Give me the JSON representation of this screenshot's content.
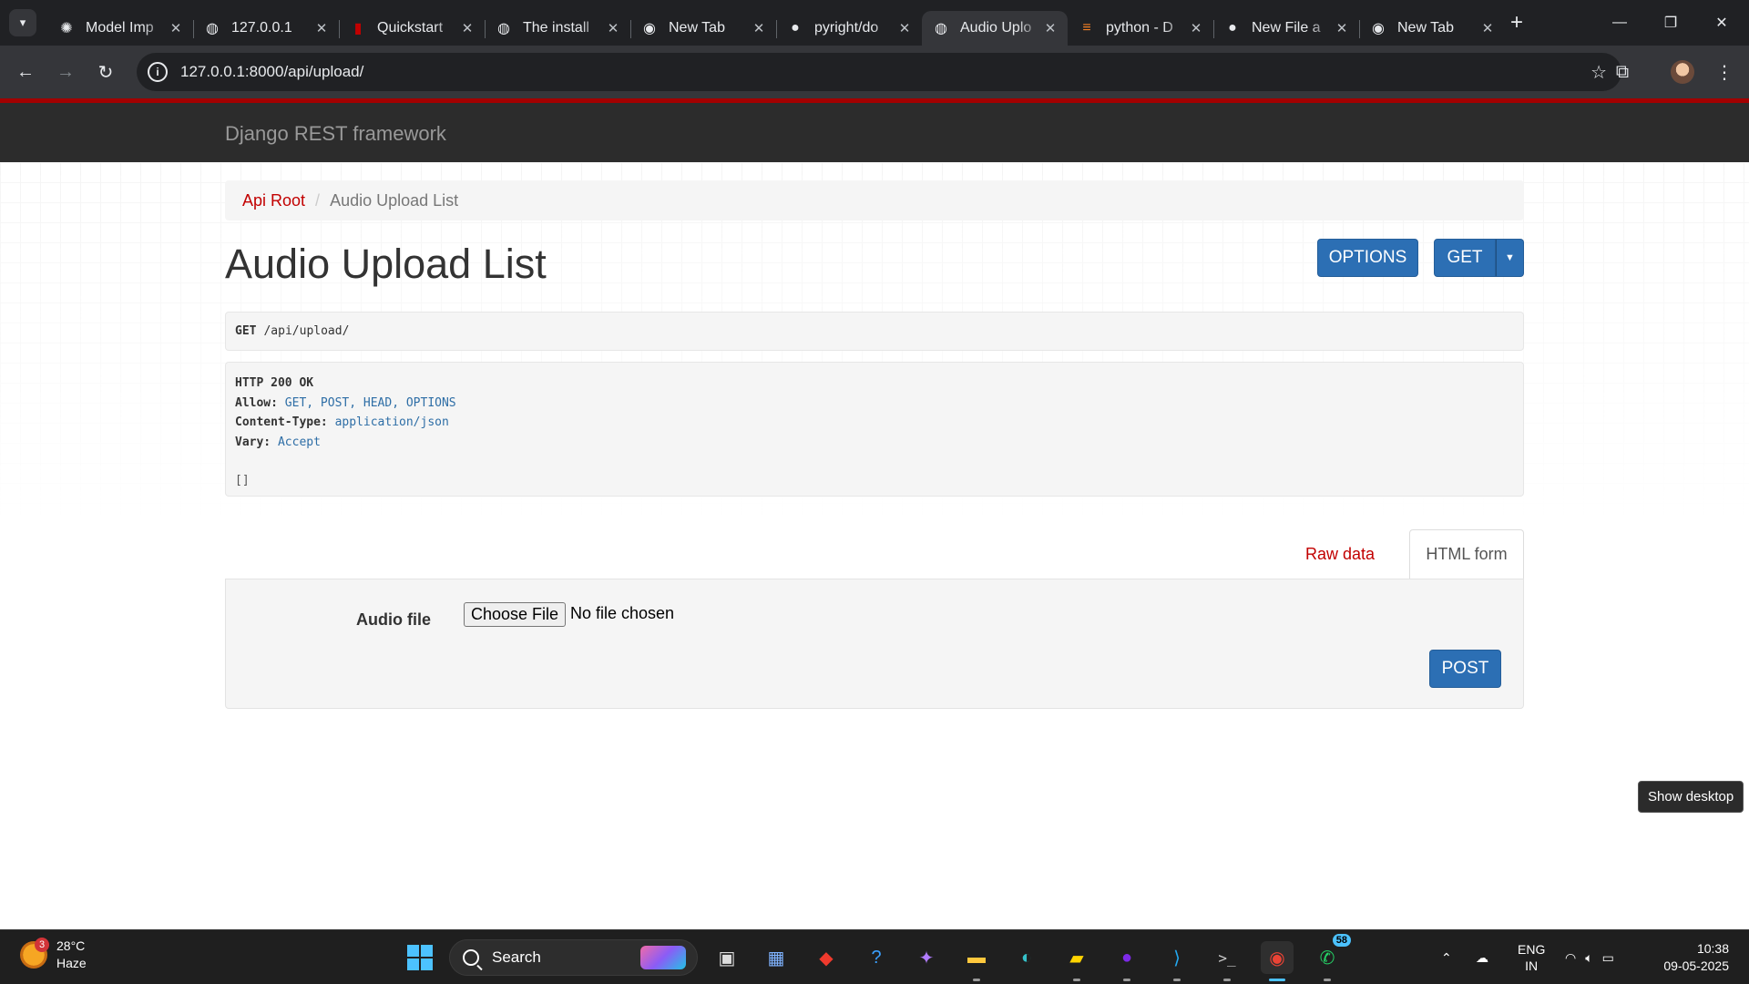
{
  "browser": {
    "tabs": [
      {
        "title": "Model Imp",
        "favicon": "openai-icon",
        "color": "#e8eaed",
        "active": false
      },
      {
        "title": "127.0.0.1",
        "favicon": "globe-icon",
        "color": "#e8eaed",
        "active": false
      },
      {
        "title": "Quickstart",
        "favicon": "django-rest-icon",
        "color": "#c20000",
        "active": false
      },
      {
        "title": "The install",
        "favicon": "globe-icon",
        "color": "#e8eaed",
        "active": false
      },
      {
        "title": "New Tab",
        "favicon": "chrome-icon",
        "color": "#e8eaed",
        "active": false
      },
      {
        "title": "pyright/do",
        "favicon": "github-icon",
        "color": "#e8eaed",
        "active": false
      },
      {
        "title": "Audio Uplo",
        "favicon": "globe-icon",
        "color": "#e8eaed",
        "active": true
      },
      {
        "title": "python - D",
        "favicon": "stackoverflow-icon",
        "color": "#f48024",
        "active": false
      },
      {
        "title": "New File a",
        "favicon": "github-icon",
        "color": "#e8eaed",
        "active": false
      },
      {
        "title": "New Tab",
        "favicon": "chrome-icon",
        "color": "#e8eaed",
        "active": false
      }
    ],
    "url": "127.0.0.1:8000/api/upload/"
  },
  "page": {
    "brand": "Django REST framework",
    "breadcrumb": {
      "root": "Api Root",
      "separator": "/",
      "current": "Audio Upload List"
    },
    "title": "Audio Upload List",
    "buttons": {
      "options": "OPTIONS",
      "get": "GET",
      "post": "POST"
    },
    "request": {
      "method": "GET",
      "path": "/api/upload/"
    },
    "response": {
      "status": "HTTP 200 OK",
      "headers": [
        {
          "key": "Allow:",
          "value": "GET, POST, HEAD, OPTIONS"
        },
        {
          "key": "Content-Type:",
          "value": "application/json"
        },
        {
          "key": "Vary:",
          "value": "Accept"
        }
      ],
      "body": "[]"
    },
    "form_tabs": {
      "raw": "Raw data",
      "html": "HTML form"
    },
    "form": {
      "label": "Audio file",
      "choose_button": "Choose File",
      "file_status": "No file chosen"
    },
    "accent_color": "#c20000",
    "button_color": "#2c6fb4"
  },
  "tooltip": "Show desktop",
  "taskbar": {
    "weather": {
      "badge": "3",
      "temp": "28°C",
      "condition": "Haze"
    },
    "search_label": "Search",
    "whatsapp_badge": "58",
    "language": {
      "line1": "ENG",
      "line2": "IN"
    },
    "time": "10:38",
    "date": "09-05-2025"
  }
}
